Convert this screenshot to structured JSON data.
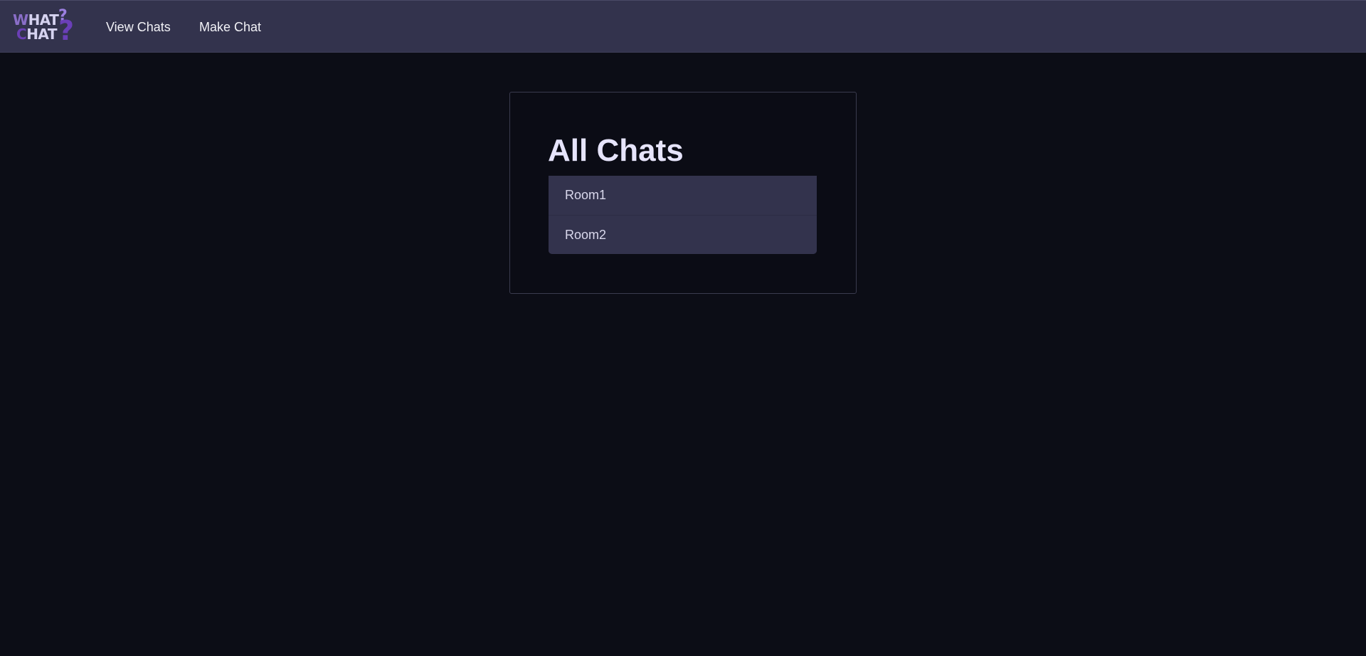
{
  "navbar": {
    "logo": {
      "line1_first": "W",
      "line1_rest": "HAT",
      "line2_first": "C",
      "line2_rest": "HAT",
      "mark_small": "?",
      "mark_large": "?"
    },
    "links": [
      {
        "label": "View Chats"
      },
      {
        "label": "Make Chat"
      }
    ]
  },
  "main": {
    "title": "All Chats",
    "chats": [
      {
        "name": "Room1"
      },
      {
        "name": "Room2"
      }
    ]
  },
  "colors": {
    "background": "#0c0d16",
    "navbar": "#33334d",
    "list_item": "#33334d",
    "logo_purple": "#6b3fb5",
    "title_text": "#e6e4fb"
  }
}
